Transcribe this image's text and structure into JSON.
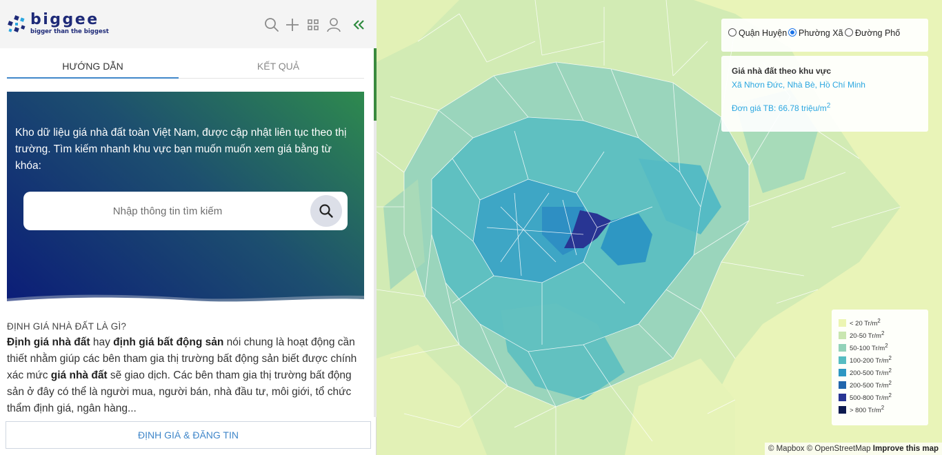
{
  "brand": {
    "name": "biggee",
    "tagline": "bigger than the biggest",
    "logo_color": "#1e2a78"
  },
  "toolbar": {
    "icons": [
      "search-icon",
      "plus-icon",
      "grid-icon",
      "user-icon",
      "collapse-icon"
    ],
    "accent": "#2e8b3e"
  },
  "tabs": [
    {
      "label": "HƯỚNG DẪN",
      "active": true
    },
    {
      "label": "KẾT QUẢ",
      "active": false
    }
  ],
  "hero": {
    "text": "Kho dữ liệu giá nhà đất toàn Việt Nam, được cập nhật liên tục theo thị trường. Tìm kiếm nhanh khu vực bạn muốn muốn xem giá bằng từ khóa:",
    "search_placeholder": "Nhập thông tin tìm kiếm"
  },
  "article": {
    "heading": "ĐỊNH GIÁ NHÀ ĐẤT LÀ GÌ?",
    "parts": [
      {
        "t": "Định giá nhà đất",
        "b": true
      },
      {
        "t": " hay ",
        "b": false
      },
      {
        "t": "định giá bất động sản",
        "b": true
      },
      {
        "t": " nói chung là hoạt động cần thiết nhằm giúp các bên tham gia thị trường bất động sản biết được chính xác mức ",
        "b": false
      },
      {
        "t": "giá nhà đất",
        "b": true
      },
      {
        "t": " sẽ giao dịch. Các bên tham gia thị trường bất động sản ở đây có thể là người mua, người bán, nhà đầu tư, môi giới, tổ chức thẩm định giá, ngân hàng...",
        "b": false
      }
    ]
  },
  "cta_label": "ĐỊNH GIÁ & ĐĂNG TIN",
  "map": {
    "level_options": [
      {
        "label": "Quận Huyện",
        "checked": false
      },
      {
        "label": "Phường Xã",
        "checked": true
      },
      {
        "label": "Đường Phố",
        "checked": false
      }
    ],
    "info": {
      "title": "Giá nhà đất theo khu vực",
      "place": "Xã Nhơn Đức, Nhà Bè, Hồ Chí Minh",
      "price_label": "Đơn giá TB: 66.78 triệu/m",
      "price_unit_sup": "2"
    },
    "legend": [
      {
        "label": "< 20 Tr/m",
        "color": "#ecf5b3"
      },
      {
        "label": "20-50 Tr/m",
        "color": "#c9e6b1"
      },
      {
        "label": "50-100 Tr/m",
        "color": "#92d2b9"
      },
      {
        "label": "100-200 Tr/m",
        "color": "#56bcc2"
      },
      {
        "label": "200-500 Tr/m",
        "color": "#2e97c3"
      },
      {
        "label": "200-500 Tr/m",
        "color": "#2166ac"
      },
      {
        "label": "500-800 Tr/m",
        "color": "#283593"
      },
      {
        "label": "> 800 Tr/m",
        "color": "#0d1a4f"
      }
    ],
    "legend_unit_sup": "2",
    "attribution": "© Mapbox © OpenStreetMap",
    "improve_link": "Improve this map"
  }
}
